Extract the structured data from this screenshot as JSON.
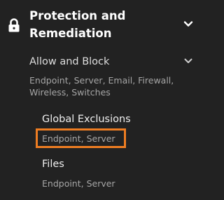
{
  "section": {
    "title": "Protection and Remediation",
    "icon": "lock-icon",
    "expanded": true
  },
  "group": {
    "title": "Allow and Block",
    "subtitle": "Endpoint, Server, Email, Firewall, Wireless, Switches",
    "expanded": true
  },
  "items": [
    {
      "title": "Global Exclusions",
      "subtitle": "Endpoint, Server",
      "highlighted": true
    },
    {
      "title": "Files",
      "subtitle": "Endpoint, Server",
      "highlighted": false
    }
  ],
  "colors": {
    "background": "#222222",
    "highlight": "#ee7d22",
    "text_primary": "#ffffff",
    "text_secondary": "#a6a6a6"
  }
}
